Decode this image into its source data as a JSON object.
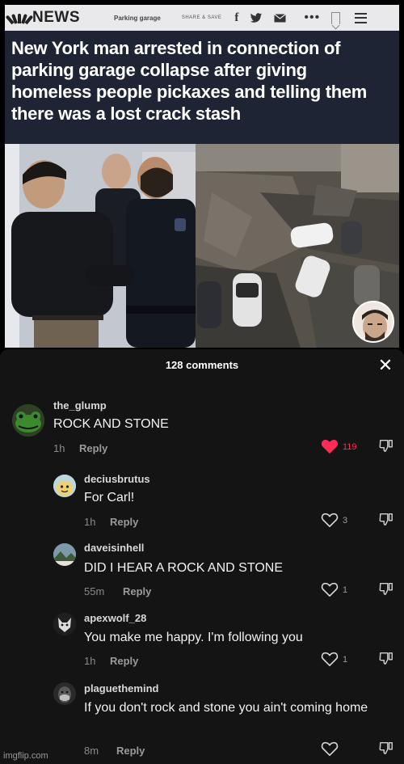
{
  "news": {
    "brand": "NEWS",
    "crumb": "Parking garage",
    "share": "SHARE & SAVE",
    "headline": "New York man arrested in connection of parking garage collapse after giving homeless people pickaxes and telling them there was a lost crack stash"
  },
  "comments_panel": {
    "title": "128 comments",
    "close_icon": "close-icon",
    "like_color": "#fe2c55",
    "comments": [
      {
        "user": "the_glump",
        "text": "ROCK AND STONE",
        "time": "1h",
        "reply": "Reply",
        "likes": "119",
        "liked": true
      },
      {
        "user": "deciusbrutus",
        "text": "For Carl!",
        "time": "1h",
        "reply": "Reply",
        "likes": "3",
        "liked": false
      },
      {
        "user": "daveisinhell",
        "text": "DID I HEAR A ROCK AND STONE",
        "time": "55m",
        "reply": "Reply",
        "likes": "1",
        "liked": false
      },
      {
        "user": "apexwolf_28",
        "text": "You make me happy. I'm following you",
        "time": "1h",
        "reply": "Reply",
        "likes": "1",
        "liked": false
      },
      {
        "user": "plaguethemind",
        "text": "If you don't rock and stone you ain't coming home",
        "time": "8m",
        "reply": "Reply",
        "likes": "",
        "liked": false
      }
    ]
  },
  "watermark": "imgflip.com"
}
